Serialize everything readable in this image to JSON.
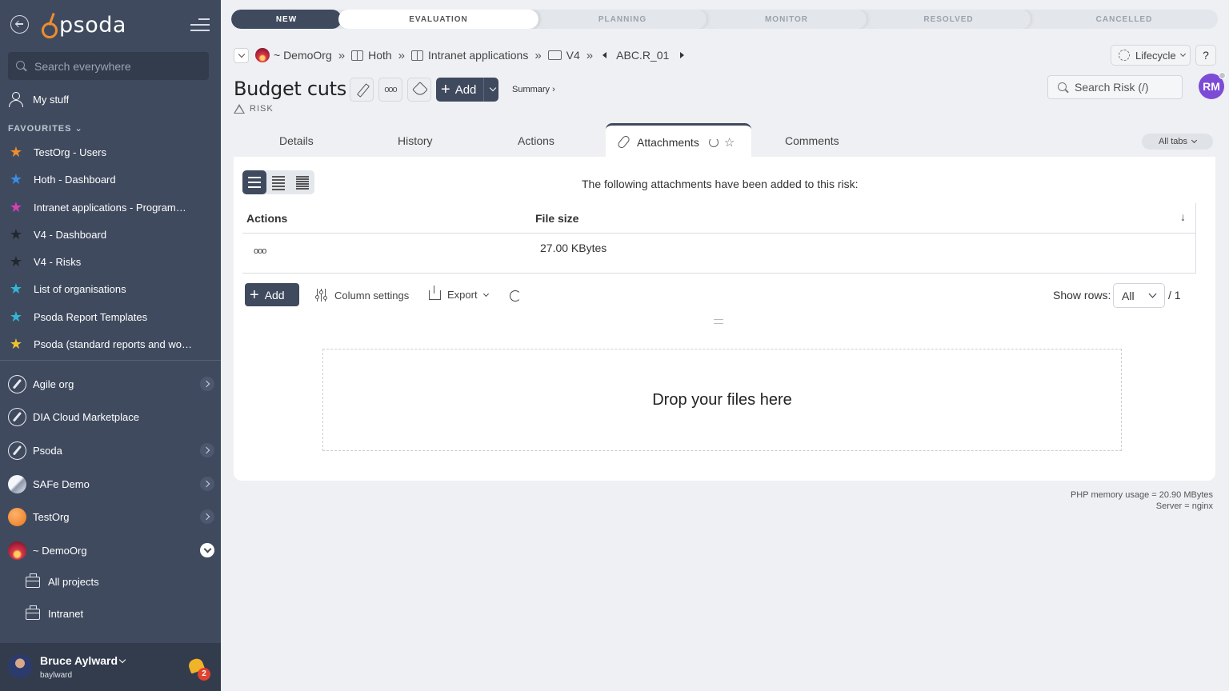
{
  "sidebar": {
    "logo_text": "psoda",
    "search_placeholder": "Search everywhere",
    "my_stuff": "My stuff",
    "favourites_label": "FAVOURITES",
    "favourites": [
      {
        "label": "TestOrg - Users",
        "color": "#f08c2e"
      },
      {
        "label": "Hoth - Dashboard",
        "color": "#3a8ee6"
      },
      {
        "label": "Intranet applications - Programme...",
        "color": "#d63fb5"
      },
      {
        "label": "V4 - Dashboard",
        "color": "#2b2f36"
      },
      {
        "label": "V4 - Risks",
        "color": "#2b2f36"
      },
      {
        "label": "List of organisations",
        "color": "#33b6d6"
      },
      {
        "label": "Psoda Report Templates",
        "color": "#33b6d6"
      },
      {
        "label": "Psoda (standard reports and work...",
        "color": "#f0c22e"
      }
    ],
    "orgs": [
      {
        "label": "Agile org"
      },
      {
        "label": "DIA Cloud Marketplace"
      },
      {
        "label": "Psoda"
      },
      {
        "label": "SAFe Demo"
      },
      {
        "label": "TestOrg"
      },
      {
        "label": "~ DemoOrg"
      }
    ],
    "sub_items": [
      {
        "label": "All projects"
      },
      {
        "label": "Intranet"
      }
    ],
    "user": {
      "name": "Bruce Aylward",
      "login": "baylward",
      "notifications": "2"
    }
  },
  "lifecycle": {
    "stages": [
      "NEW",
      "EVALUATION",
      "PLANNING",
      "MONITOR",
      "RESOLVED",
      "CANCELLED"
    ]
  },
  "breadcrumb": {
    "org": "~ DemoOrg",
    "items": [
      "Hoth",
      "Intranet applications",
      "V4"
    ],
    "current": "ABC.R_01",
    "separator": "»"
  },
  "header": {
    "lifecycle_button": "Lifecycle",
    "help": "?",
    "title": "Budget cuts",
    "type_label": "RISK",
    "add_label": "Add",
    "summary_link": "Summary ›",
    "search_placeholder": "Search Risk (/)",
    "avatar_initials": "RM"
  },
  "tabs": {
    "items": [
      "Details",
      "History",
      "Actions",
      "Attachments",
      "Comments"
    ],
    "active": "Attachments",
    "all_tabs": "All tabs"
  },
  "attachments": {
    "intro": "The following attachments have been added to this risk:",
    "columns": [
      "Actions",
      "File size"
    ],
    "sort_icon": "↓",
    "rows": [
      {
        "actions": "ooo",
        "file_size": "27.00 KBytes"
      }
    ],
    "add_label": "Add",
    "column_settings": "Column settings",
    "export": "Export",
    "show_rows_label": "Show rows:",
    "show_rows_value": "All",
    "total": "/ 1",
    "dropzone": "Drop your files here"
  },
  "footer": {
    "memory": "PHP memory usage = 20.90 MBytes",
    "server": "Server = nginx"
  }
}
